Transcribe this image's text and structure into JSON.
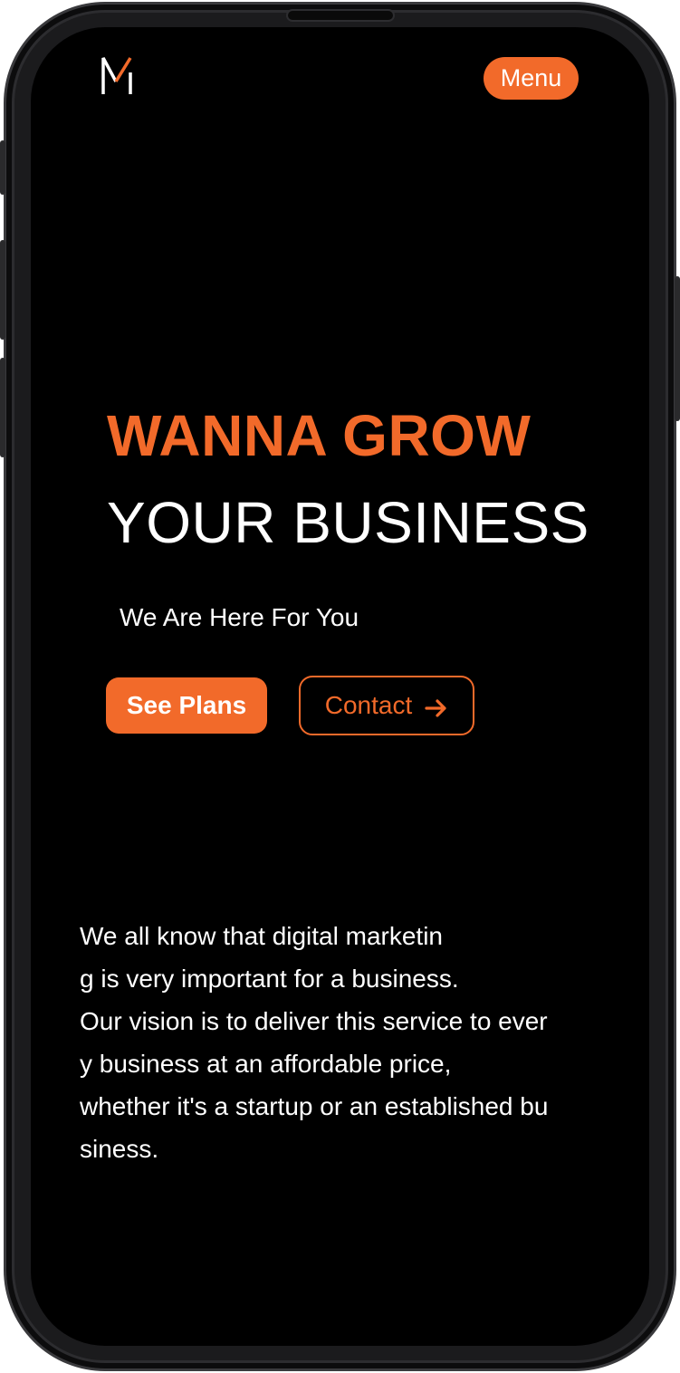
{
  "header": {
    "logo_icon": "m-monogram-logo",
    "menu_label": "Menu"
  },
  "hero": {
    "headline_line1": "WANNA GROW",
    "headline_line2": "YOUR BUSINESS",
    "subheadline": "We Are Here For You",
    "primary_cta": "See Plans",
    "secondary_cta": "Contact",
    "secondary_cta_icon": "arrow-right-icon"
  },
  "about": {
    "lines": [
      "We all know that digital marketin",
      "g is very important for a business.",
      "Our vision is to deliver this service to ever",
      "y business at an affordable price,",
      "whether it's a startup or an established bu",
      "siness."
    ]
  },
  "colors": {
    "accent": "#f26a2a",
    "background": "#000000",
    "text": "#ffffff"
  }
}
